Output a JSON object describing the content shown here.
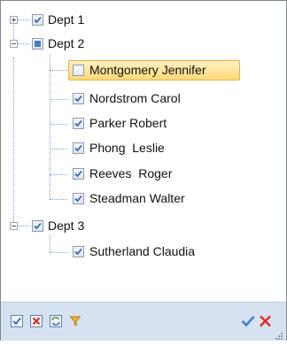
{
  "tree": {
    "groups": [
      {
        "label": "Dept 1",
        "expanded": false,
        "check_state": "checked",
        "items": []
      },
      {
        "label": "Dept 2",
        "expanded": true,
        "check_state": "indeterminate",
        "items": [
          {
            "label": "Montgomery Jennifer",
            "checked": false,
            "selected": true
          },
          {
            "label": "Nordstrom Carol",
            "checked": true,
            "selected": false
          },
          {
            "label": "Parker Robert",
            "checked": true,
            "selected": false
          },
          {
            "label": "Phong  Leslie",
            "checked": true,
            "selected": false
          },
          {
            "label": "Reeves  Roger",
            "checked": true,
            "selected": false
          },
          {
            "label": "Steadman Walter",
            "checked": true,
            "selected": false
          }
        ]
      },
      {
        "label": "Dept 3",
        "expanded": true,
        "check_state": "checked",
        "items": [
          {
            "label": "Sutherland Claudia",
            "checked": true,
            "selected": false
          }
        ]
      }
    ]
  },
  "toolbar": {
    "buttons": [
      {
        "icon": "check-all-icon"
      },
      {
        "icon": "uncheck-all-icon"
      },
      {
        "icon": "invert-check-icon"
      },
      {
        "icon": "filter-icon"
      },
      {
        "icon": "ok-checkmark-icon"
      },
      {
        "icon": "cancel-x-icon"
      }
    ]
  },
  "colors": {
    "selection_fill": "#ffd978",
    "selection_border": "#e3b14b",
    "toolbar_bg": "#d6e2f1",
    "accent_blue": "#4a7fc8",
    "cancel_red": "#e02b20"
  }
}
